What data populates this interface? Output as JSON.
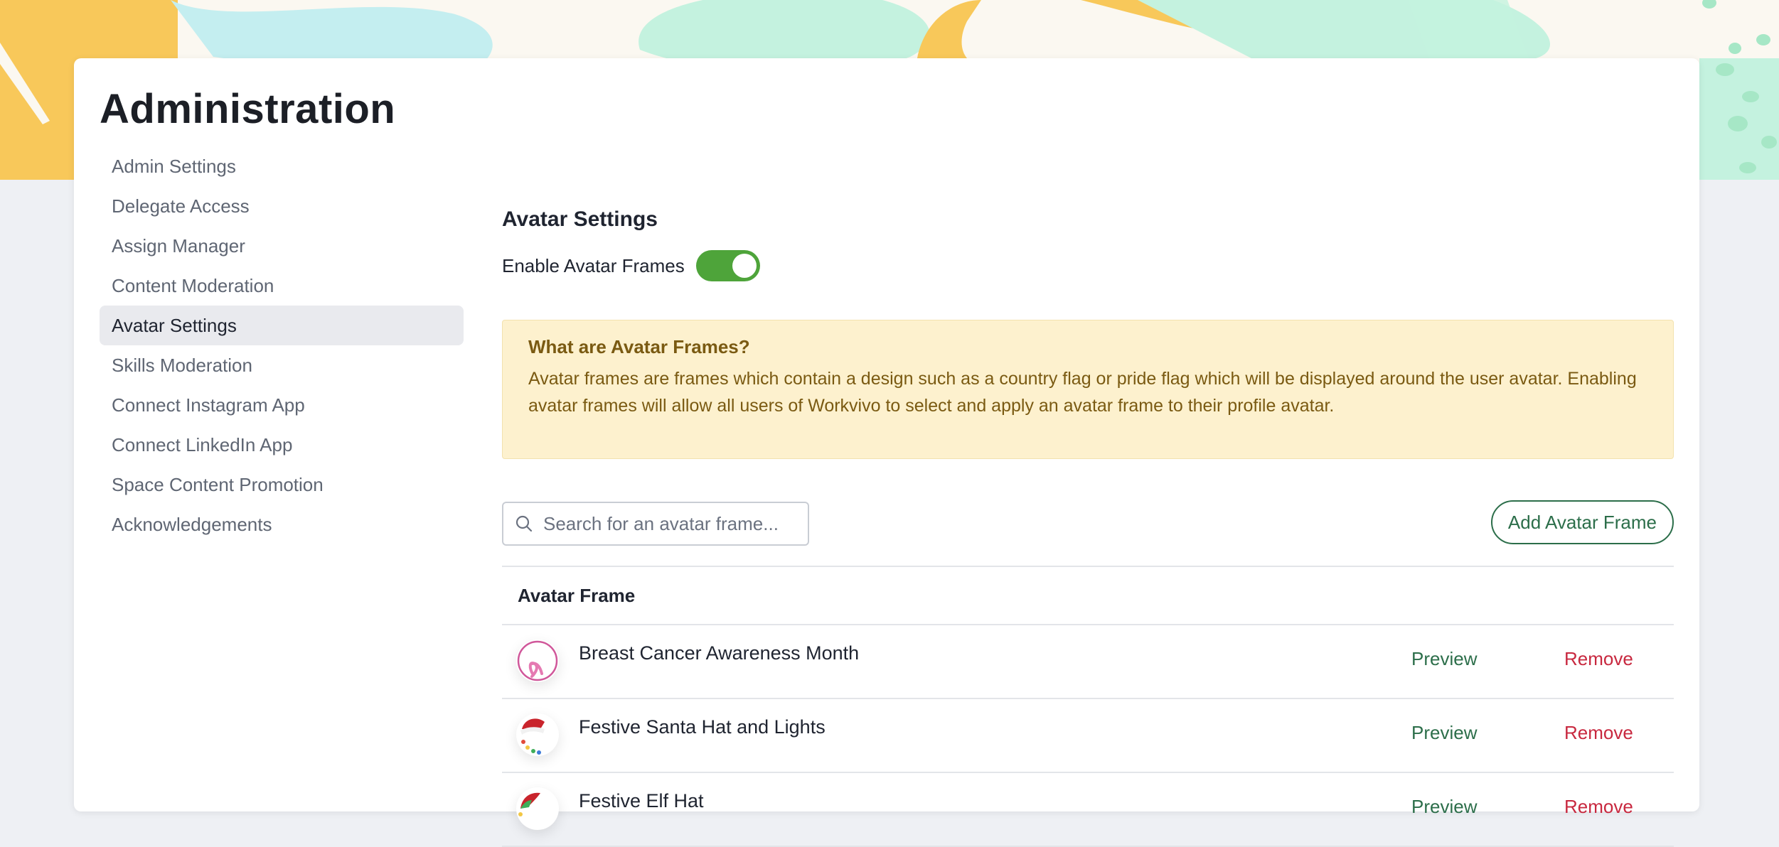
{
  "page_title": "Administration",
  "sidebar": {
    "items": [
      {
        "label": "Admin Settings",
        "active": false
      },
      {
        "label": "Delegate Access",
        "active": false
      },
      {
        "label": "Assign Manager",
        "active": false
      },
      {
        "label": "Content Moderation",
        "active": false
      },
      {
        "label": "Avatar Settings",
        "active": true
      },
      {
        "label": "Skills Moderation",
        "active": false
      },
      {
        "label": "Connect Instagram App",
        "active": false
      },
      {
        "label": "Connect LinkedIn App",
        "active": false
      },
      {
        "label": "Space Content Promotion",
        "active": false
      },
      {
        "label": "Acknowledgements",
        "active": false
      }
    ]
  },
  "main": {
    "section_title": "Avatar Settings",
    "toggle": {
      "label": "Enable Avatar Frames",
      "enabled": true
    },
    "info": {
      "title": "What are Avatar Frames?",
      "text": "Avatar frames are frames which contain a design such as a country flag or pride flag which will be displayed around the user avatar. Enabling avatar frames will allow all users of Workvivo to select and apply an avatar frame to their profile avatar."
    },
    "search": {
      "placeholder": "Search for an avatar frame...",
      "value": ""
    },
    "add_button": "Add Avatar Frame",
    "table": {
      "header": "Avatar Frame",
      "rows": [
        {
          "name": "Breast Cancer Awareness Month",
          "icon": "pink-ribbon-frame-icon",
          "preview": "Preview",
          "remove": "Remove"
        },
        {
          "name": "Festive Santa Hat and Lights",
          "icon": "santa-hat-frame-icon",
          "preview": "Preview",
          "remove": "Remove"
        },
        {
          "name": "Festive Elf Hat",
          "icon": "elf-hat-frame-icon",
          "preview": "Preview",
          "remove": "Remove"
        }
      ]
    }
  },
  "colors": {
    "toggle_on": "#4ea43a",
    "accent_green": "#2c6e4a",
    "danger_red": "#c8283f",
    "info_bg": "#fdf1ce",
    "info_text": "#7a5a12"
  }
}
